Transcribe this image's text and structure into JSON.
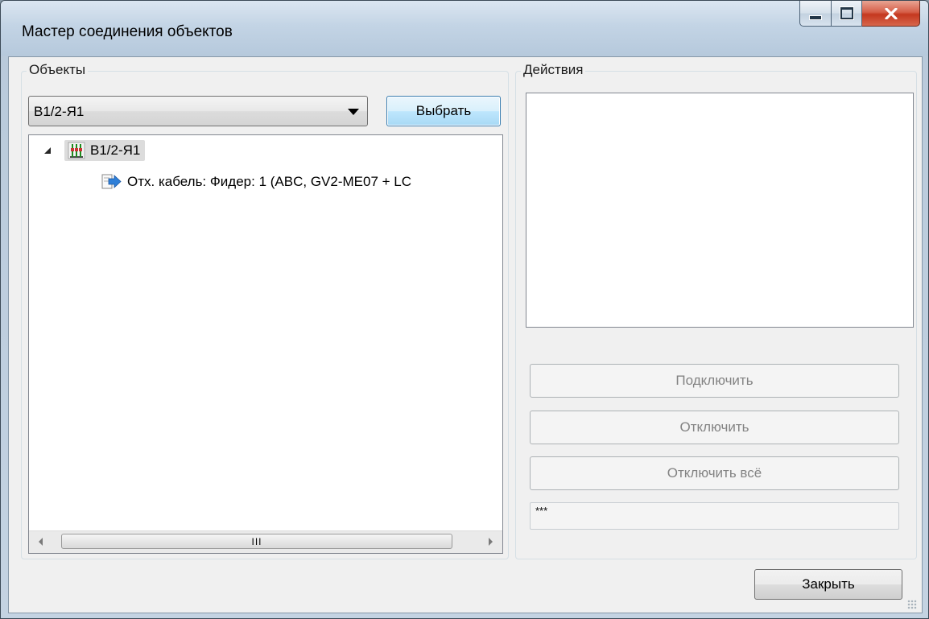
{
  "window": {
    "title": "Мастер соединения объектов",
    "min_icon": "minimize-icon",
    "max_icon": "maximize-icon",
    "close_icon": "close-icon"
  },
  "objects_group": {
    "label": "Объекты",
    "combo_value": "В1/2-Я1",
    "select_button": "Выбрать",
    "tree": {
      "root": {
        "label": "В1/2-Я1",
        "icon": "switchboard-icon",
        "expanded": true
      },
      "children": [
        {
          "label": "Отх. кабель: Фидер: 1 (ABC, GV2-ME07 + LC",
          "icon": "outgoing-cable-icon"
        }
      ],
      "scroll_thumb": "III"
    }
  },
  "actions_group": {
    "label": "Действия",
    "buttons": {
      "connect": "Подключить",
      "disconnect": "Отключить",
      "disconnect_all": "Отключить всё"
    },
    "status_text": "***"
  },
  "footer": {
    "close_button": "Закрыть"
  },
  "colors": {
    "accent": "#3c7fb1",
    "close_red": "#c4381f",
    "disabled_text": "#838383"
  }
}
